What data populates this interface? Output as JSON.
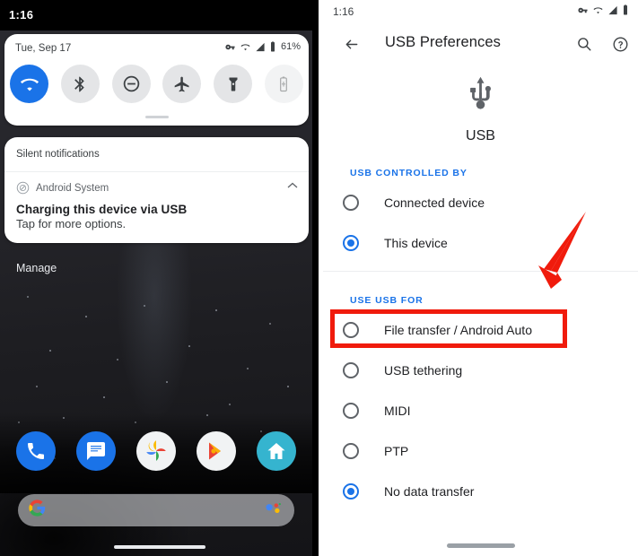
{
  "left_phone": {
    "status_bar": {
      "clock": "1:16",
      "icons": [
        "vpn-key-icon",
        "wifi-icon",
        "cell-signal-icon",
        "battery-icon"
      ]
    },
    "quick_settings": {
      "date": "Tue, Sep 17",
      "battery_percent": "61%",
      "status_icons": [
        "vpn-key-icon",
        "wifi-icon",
        "cell-signal-icon",
        "battery-icon"
      ],
      "tiles": [
        {
          "name": "wifi-tile",
          "icon": "wifi-icon",
          "state": "on"
        },
        {
          "name": "bluetooth-tile",
          "icon": "bluetooth-icon",
          "state": "off"
        },
        {
          "name": "do-not-disturb-tile",
          "icon": "do-not-disturb-icon",
          "state": "off"
        },
        {
          "name": "airplane-mode-tile",
          "icon": "airplane-icon",
          "state": "off"
        },
        {
          "name": "flashlight-tile",
          "icon": "flashlight-icon",
          "state": "off"
        },
        {
          "name": "battery-saver-tile",
          "icon": "battery-saver-icon",
          "state": "disabled"
        }
      ]
    },
    "notifications": {
      "section_header": "Silent notifications",
      "app_name": "Android System",
      "app_icon": "android-system-icon",
      "collapse_icon": "chevron-up-icon",
      "title": "Charging this device via USB",
      "subtitle": "Tap for more options.",
      "manage_label": "Manage"
    },
    "dock": [
      {
        "name": "phone-app-icon",
        "label": "Phone"
      },
      {
        "name": "messages-app-icon",
        "label": "Messages"
      },
      {
        "name": "photos-app-icon",
        "label": "Photos"
      },
      {
        "name": "play-store-app-icon",
        "label": "Play Store"
      },
      {
        "name": "home-app-icon",
        "label": "Home"
      }
    ],
    "search_bar": {
      "google-logo": "G",
      "assistant_icon": "google-assistant-icon",
      "placeholder": ""
    }
  },
  "right_phone": {
    "status_bar": {
      "clock": "1:16",
      "icons": [
        "vpn-key-icon",
        "wifi-icon",
        "cell-signal-icon",
        "battery-icon"
      ]
    },
    "app_bar": {
      "back_icon": "back-arrow-icon",
      "title": "USB Preferences",
      "search_icon": "search-icon",
      "help_icon": "help-circle-icon"
    },
    "hero": {
      "icon": "usb-icon",
      "label": "USB"
    },
    "sections": [
      {
        "title": "USB CONTROLLED BY",
        "options": [
          {
            "label": "Connected device",
            "selected": false
          },
          {
            "label": "This device",
            "selected": true
          }
        ]
      },
      {
        "title": "USE USB FOR",
        "options": [
          {
            "label": "File transfer / Android Auto",
            "selected": false,
            "highlighted": true
          },
          {
            "label": "USB tethering",
            "selected": false
          },
          {
            "label": "MIDI",
            "selected": false
          },
          {
            "label": "PTP",
            "selected": false
          },
          {
            "label": "No data transfer",
            "selected": true
          }
        ]
      }
    ]
  },
  "annotations": {
    "highlight_color": "#f01b0c",
    "arrow_color": "#f01b0c",
    "accent_color": "#1a73e8",
    "target_label": "File transfer / Android Auto"
  }
}
